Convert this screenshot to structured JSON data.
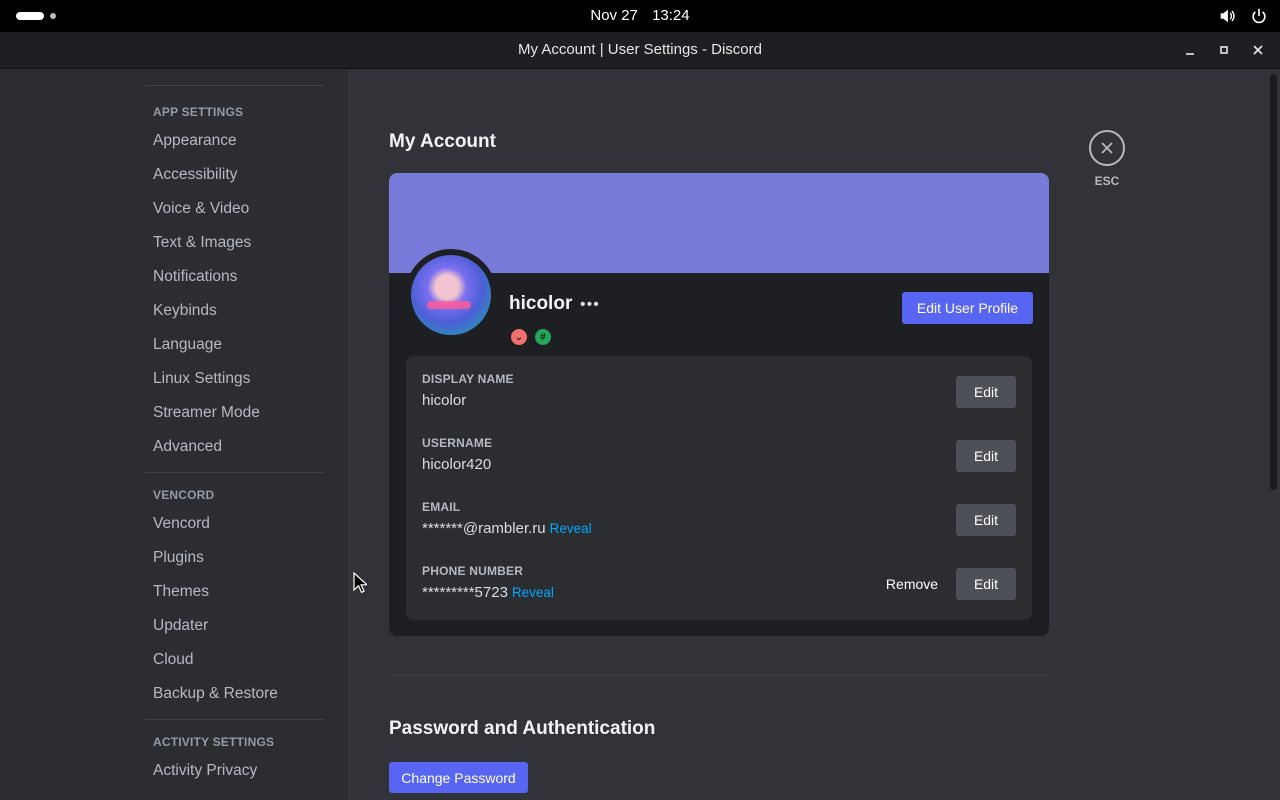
{
  "system": {
    "date": "Nov 27",
    "time": "13:24",
    "tray_icons": [
      "volume-icon",
      "power-icon"
    ]
  },
  "window": {
    "title": "My Account | User Settings - Discord"
  },
  "sidebar": {
    "sections": [
      {
        "heading": "APP SETTINGS",
        "items": [
          "Appearance",
          "Accessibility",
          "Voice & Video",
          "Text & Images",
          "Notifications",
          "Keybinds",
          "Language",
          "Linux Settings",
          "Streamer Mode",
          "Advanced"
        ]
      },
      {
        "heading": "VENCORD",
        "items": [
          "Vencord",
          "Plugins",
          "Themes",
          "Updater",
          "Cloud",
          "Backup & Restore"
        ]
      },
      {
        "heading": "ACTIVITY SETTINGS",
        "items": [
          "Activity Privacy"
        ]
      }
    ]
  },
  "main": {
    "page_title": "My Account",
    "close_label": "ESC",
    "profile": {
      "banner_color": "#777ad8",
      "username": "hicolor",
      "more_label": "•••",
      "edit_profile_label": "Edit User Profile",
      "badges": [
        "nitro-badge-icon",
        "hypesquad-badge-icon"
      ]
    },
    "fields": [
      {
        "label": "DISPLAY NAME",
        "value": "hicolor",
        "reveal": "",
        "edit": "Edit",
        "remove": ""
      },
      {
        "label": "USERNAME",
        "value": "hicolor420",
        "reveal": "",
        "edit": "Edit",
        "remove": ""
      },
      {
        "label": "EMAIL",
        "value": "*******@rambler.ru",
        "reveal": "Reveal",
        "edit": "Edit",
        "remove": ""
      },
      {
        "label": "PHONE NUMBER",
        "value": "*********5723",
        "reveal": "Reveal",
        "edit": "Edit",
        "remove": "Remove"
      }
    ],
    "password_section": {
      "title": "Password and Authentication",
      "change_password_label": "Change Password"
    }
  },
  "colors": {
    "accent": "#5865f2",
    "link": "#00a8fc",
    "background": "#313338",
    "sidebar": "#2b2d31"
  }
}
